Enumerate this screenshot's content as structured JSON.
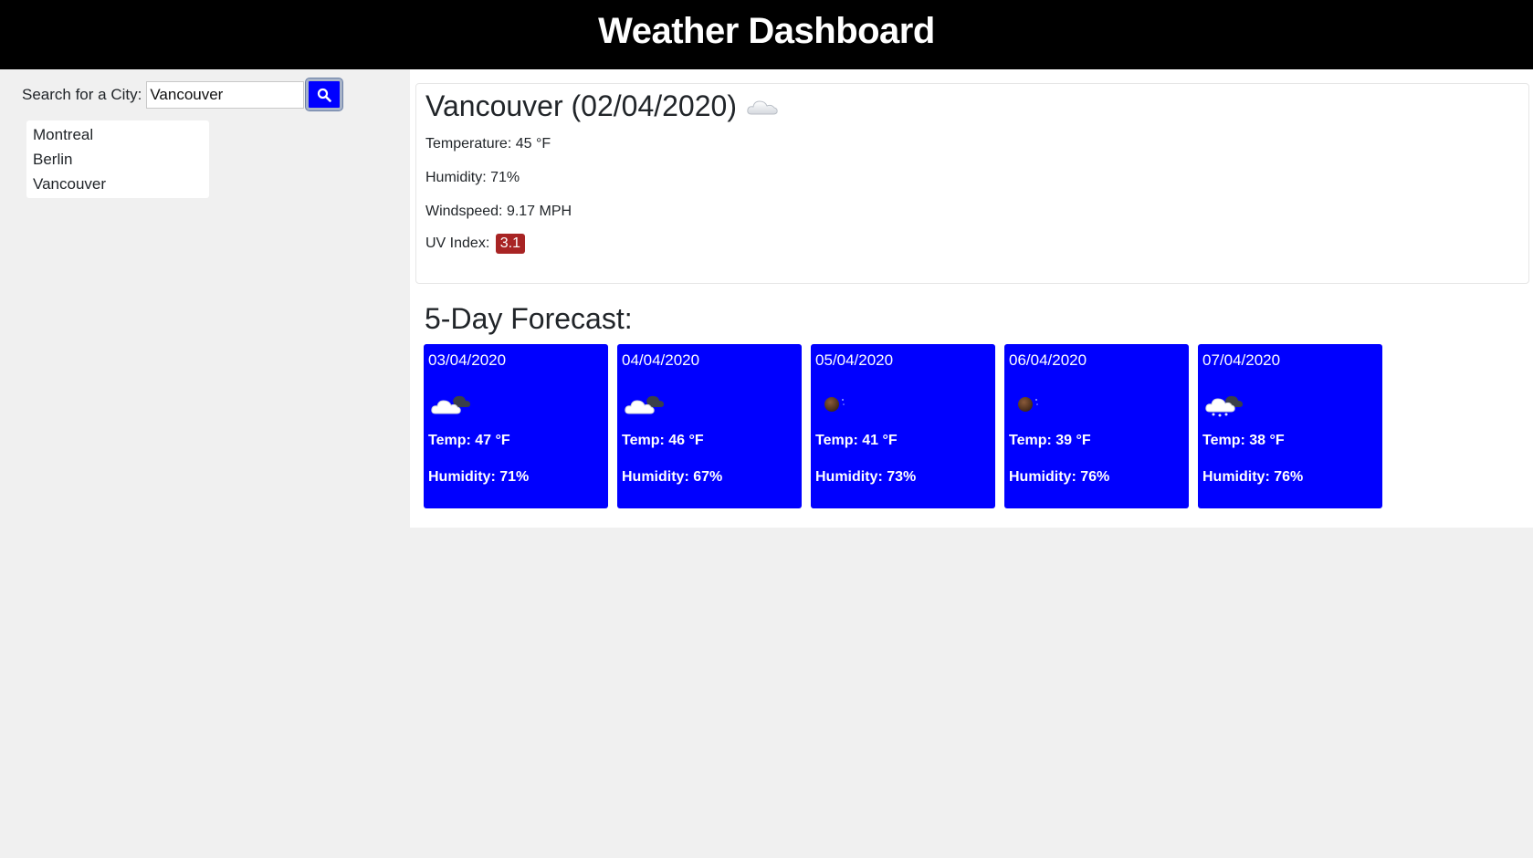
{
  "header": {
    "title": "Weather Dashboard"
  },
  "search": {
    "label": "Search for a City:",
    "value": "Vancouver",
    "button_icon": "search-icon"
  },
  "history": [
    "Montreal",
    "Berlin",
    "Vancouver"
  ],
  "current": {
    "title": "Vancouver (02/04/2020)",
    "icon": "cloud-icon",
    "temperature": "Temperature: 45 °F",
    "humidity": "Humidity: 71%",
    "windspeed": "Windspeed: 9.17 MPH",
    "uv_label": "UV Index:",
    "uv_value": "3.1",
    "uv_color": "#a82424"
  },
  "forecast": {
    "title": "5-Day Forecast:",
    "card_color": "#0000ff",
    "days": [
      {
        "date": "03/04/2020",
        "icon": "cloudy-icon",
        "temp": "Temp: 47 °F",
        "humidity": "Humidity: 71%"
      },
      {
        "date": "04/04/2020",
        "icon": "cloudy-icon",
        "temp": "Temp: 46 °F",
        "humidity": "Humidity: 67%"
      },
      {
        "date": "05/04/2020",
        "icon": "night-clear-icon",
        "temp": "Temp: 41 °F",
        "humidity": "Humidity: 73%"
      },
      {
        "date": "06/04/2020",
        "icon": "night-clear-icon",
        "temp": "Temp: 39 °F",
        "humidity": "Humidity: 76%"
      },
      {
        "date": "07/04/2020",
        "icon": "snow-cloud-icon",
        "temp": "Temp: 38 °F",
        "humidity": "Humidity: 76%"
      }
    ]
  }
}
